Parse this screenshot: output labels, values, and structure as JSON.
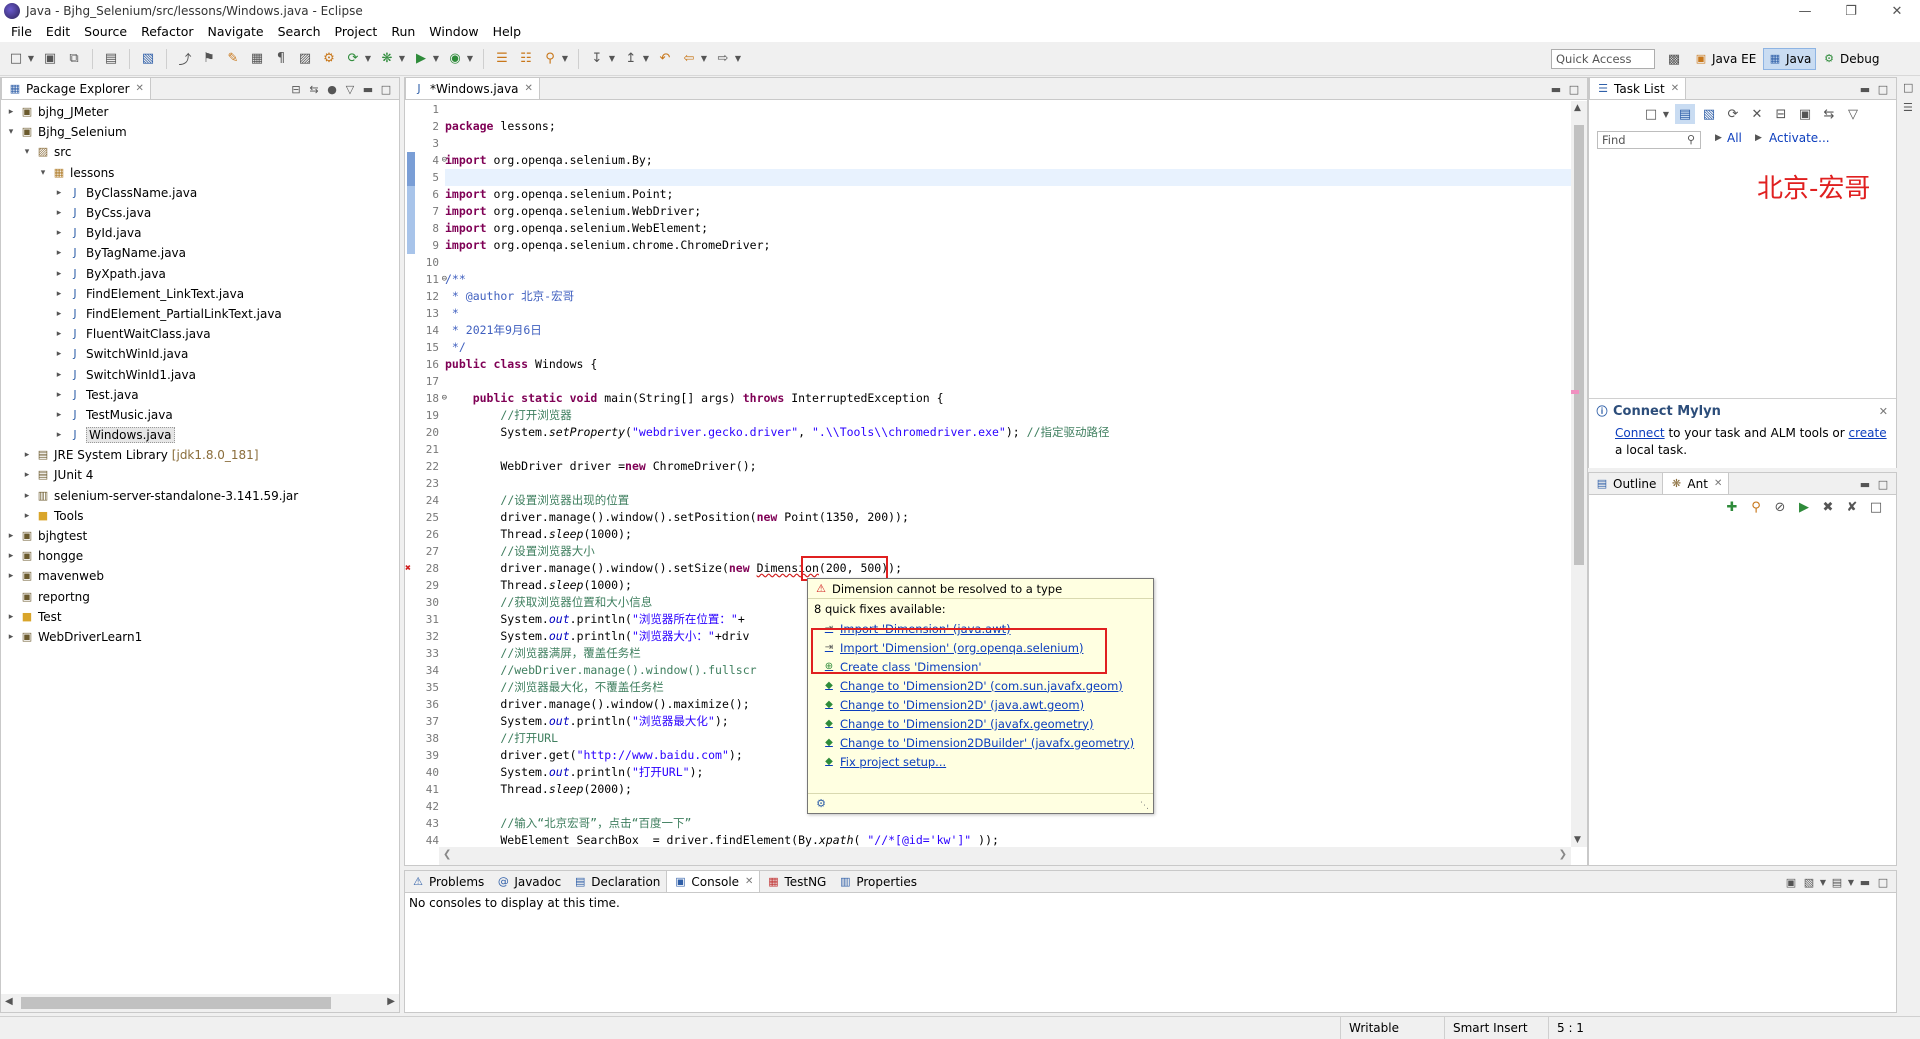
{
  "window": {
    "title": "Java - Bjhg_Selenium/src/lessons/Windows.java - Eclipse"
  },
  "menu": [
    "File",
    "Edit",
    "Source",
    "Refactor",
    "Navigate",
    "Search",
    "Project",
    "Run",
    "Window",
    "Help"
  ],
  "toolbar": {
    "quick_access_placeholder": "Quick Access",
    "perspectives": [
      {
        "label": "Java EE",
        "active": false
      },
      {
        "label": "Java",
        "active": true
      },
      {
        "label": "Debug",
        "active": false
      }
    ]
  },
  "package_explorer": {
    "tab": "Package Explorer",
    "items": [
      {
        "label": "bjhg_JMeter",
        "depth": 0,
        "toggle": "▸",
        "icon": "project-icon",
        "selected": false
      },
      {
        "label": "Bjhg_Selenium",
        "depth": 0,
        "toggle": "▾",
        "icon": "project-icon",
        "selected": false
      },
      {
        "label": "src",
        "depth": 1,
        "toggle": "▾",
        "icon": "source-folder-icon",
        "selected": false
      },
      {
        "label": "lessons",
        "depth": 2,
        "toggle": "▾",
        "icon": "package-icon",
        "selected": false
      },
      {
        "label": "ByClassName.java",
        "depth": 3,
        "toggle": "▸",
        "icon": "java-file-icon",
        "selected": false
      },
      {
        "label": "ByCss.java",
        "depth": 3,
        "toggle": "▸",
        "icon": "java-file-icon",
        "selected": false
      },
      {
        "label": "ById.java",
        "depth": 3,
        "toggle": "▸",
        "icon": "java-file-icon",
        "selected": false
      },
      {
        "label": "ByTagName.java",
        "depth": 3,
        "toggle": "▸",
        "icon": "java-file-icon",
        "selected": false
      },
      {
        "label": "ByXpath.java",
        "depth": 3,
        "toggle": "▸",
        "icon": "java-file-icon",
        "selected": false
      },
      {
        "label": "FindElement_LinkText.java",
        "depth": 3,
        "toggle": "▸",
        "icon": "java-file-icon",
        "selected": false
      },
      {
        "label": "FindElement_PartialLinkText.java",
        "depth": 3,
        "toggle": "▸",
        "icon": "java-file-icon",
        "selected": false
      },
      {
        "label": "FluentWaitClass.java",
        "depth": 3,
        "toggle": "▸",
        "icon": "java-file-icon",
        "selected": false
      },
      {
        "label": "SwitchWinId.java",
        "depth": 3,
        "toggle": "▸",
        "icon": "java-file-icon",
        "selected": false
      },
      {
        "label": "SwitchWinId1.java",
        "depth": 3,
        "toggle": "▸",
        "icon": "java-file-icon",
        "selected": false
      },
      {
        "label": "Test.java",
        "depth": 3,
        "toggle": "▸",
        "icon": "java-file-icon",
        "selected": false
      },
      {
        "label": "TestMusic.java",
        "depth": 3,
        "toggle": "▸",
        "icon": "java-file-icon",
        "selected": false
      },
      {
        "label": "Windows.java",
        "depth": 3,
        "toggle": "▸",
        "icon": "java-file-icon",
        "selected": true
      },
      {
        "label": "JRE System Library",
        "suffix": "[jdk1.8.0_181]",
        "depth": 1,
        "toggle": "▸",
        "icon": "library-icon",
        "selected": false
      },
      {
        "label": "JUnit 4",
        "depth": 1,
        "toggle": "▸",
        "icon": "library-icon",
        "selected": false
      },
      {
        "label": "selenium-server-standalone-3.141.59.jar",
        "depth": 1,
        "toggle": "▸",
        "icon": "jar-icon",
        "selected": false
      },
      {
        "label": "Tools",
        "depth": 1,
        "toggle": "▸",
        "icon": "folder-icon",
        "selected": false
      },
      {
        "label": "bjhgtest",
        "depth": 0,
        "toggle": "▸",
        "icon": "project-icon",
        "selected": false
      },
      {
        "label": "hongge",
        "depth": 0,
        "toggle": "▸",
        "icon": "project-icon",
        "selected": false
      },
      {
        "label": "mavenweb",
        "depth": 0,
        "toggle": "▸",
        "icon": "project-icon",
        "selected": false
      },
      {
        "label": "reportng",
        "depth": 0,
        "toggle": "",
        "icon": "project-icon",
        "selected": false
      },
      {
        "label": "Test",
        "depth": 0,
        "toggle": "▸",
        "icon": "folder-icon",
        "selected": false
      },
      {
        "label": "WebDriverLearn1",
        "depth": 0,
        "toggle": "▸",
        "icon": "project-icon",
        "selected": false
      }
    ]
  },
  "editor": {
    "tab": "*Windows.java",
    "current_line": 5,
    "lines": [
      {
        "n": "1",
        "marker": "",
        "html": ""
      },
      {
        "n": "2",
        "marker": "",
        "html": "<span class=\"kw\">package</span> lessons;"
      },
      {
        "n": "3",
        "marker": "",
        "html": ""
      },
      {
        "n": "4",
        "marker": "⊖",
        "html": "<span class=\"kw\">import</span> org.openqa.selenium.By;"
      },
      {
        "n": "5",
        "marker": "",
        "html": ""
      },
      {
        "n": "6",
        "marker": "",
        "html": "<span class=\"kw\">import</span> org.openqa.selenium.Point;"
      },
      {
        "n": "7",
        "marker": "",
        "html": "<span class=\"kw\">import</span> org.openqa.selenium.WebDriver;"
      },
      {
        "n": "8",
        "marker": "",
        "html": "<span class=\"kw\">import</span> org.openqa.selenium.WebElement;"
      },
      {
        "n": "9",
        "marker": "",
        "html": "<span class=\"kw\">import</span> org.openqa.selenium.chrome.ChromeDriver;"
      },
      {
        "n": "10",
        "marker": "",
        "html": ""
      },
      {
        "n": "11",
        "marker": "⊖",
        "html": "<span class=\"jd\">/**</span>"
      },
      {
        "n": "12",
        "marker": "",
        "html": "<span class=\"jd\"> * @author 北京-宏哥</span>"
      },
      {
        "n": "13",
        "marker": "",
        "html": "<span class=\"jd\"> *</span>"
      },
      {
        "n": "14",
        "marker": "",
        "html": "<span class=\"jd\"> * 2021年9月6日</span>"
      },
      {
        "n": "15",
        "marker": "",
        "html": "<span class=\"jd\"> */</span>"
      },
      {
        "n": "16",
        "marker": "",
        "html": "<span class=\"kw\">public class</span> Windows {"
      },
      {
        "n": "17",
        "marker": "",
        "html": ""
      },
      {
        "n": "18",
        "marker": "⊖",
        "html": "    <span class=\"kw\">public static void</span> main(String[] args) <span class=\"kw\">throws</span> InterruptedException {"
      },
      {
        "n": "19",
        "marker": "",
        "html": "        <span class=\"cm\">//打开浏览器</span>"
      },
      {
        "n": "20",
        "marker": "",
        "html": "        System.<i>setProperty</i>(<span class=\"st\">\"webdriver.gecko.driver\"</span>, <span class=\"st\">\".\\\\Tools\\\\chromedriver.exe\"</span>); <span class=\"cm\">//指定驱动路径</span>"
      },
      {
        "n": "21",
        "marker": "",
        "html": ""
      },
      {
        "n": "22",
        "marker": "",
        "html": "        WebDriver driver =<span class=\"kw\">new</span> ChromeDriver();"
      },
      {
        "n": "23",
        "marker": "",
        "html": ""
      },
      {
        "n": "24",
        "marker": "",
        "html": "        <span class=\"cm\">//设置浏览器出现的位置</span>"
      },
      {
        "n": "25",
        "marker": "",
        "html": "        driver.manage().window().setPosition(<span class=\"kw\">new</span> Point(1350, 200));"
      },
      {
        "n": "26",
        "marker": "",
        "html": "        Thread.<i>sleep</i>(1000);"
      },
      {
        "n": "27",
        "marker": "",
        "html": "        <span class=\"cm\">//设置浏览器大小</span>"
      },
      {
        "n": "28",
        "marker": "err",
        "html": "        driver.manage().window().setSize(<span class=\"kw\">new</span> Dimension(200, 500));"
      },
      {
        "n": "29",
        "marker": "",
        "html": "        Thread.<i>sleep</i>(1000);"
      },
      {
        "n": "30",
        "marker": "",
        "html": "        <span class=\"cm\">//获取浏览器位置和大小信息</span>"
      },
      {
        "n": "31",
        "marker": "",
        "html": "        System.<span class=\"fld it\">out</span>.println(<span class=\"st\">\"浏览器所在位置：\"</span>+"
      },
      {
        "n": "32",
        "marker": "",
        "html": "        System.<span class=\"fld it\">out</span>.println(<span class=\"st\">\"浏览器大小：\"</span>+driv"
      },
      {
        "n": "33",
        "marker": "",
        "html": "        <span class=\"cm\">//浏览器满屏，覆盖任务栏</span>"
      },
      {
        "n": "34",
        "marker": "",
        "html": "        <span class=\"cm\">//webDriver.manage().window().fullscr</span>"
      },
      {
        "n": "35",
        "marker": "",
        "html": "        <span class=\"cm\">//浏览器最大化，不覆盖任务栏</span>"
      },
      {
        "n": "36",
        "marker": "",
        "html": "        driver.manage().window().maximize();"
      },
      {
        "n": "37",
        "marker": "",
        "html": "        System.<span class=\"fld it\">out</span>.println(<span class=\"st\">\"浏览器最大化\"</span>);"
      },
      {
        "n": "38",
        "marker": "",
        "html": "        <span class=\"cm\">//打开URL</span>"
      },
      {
        "n": "39",
        "marker": "",
        "html": "        driver.get(<span class=\"st\">\"http://www.baidu.com\"</span>);"
      },
      {
        "n": "40",
        "marker": "",
        "html": "        System.<span class=\"fld it\">out</span>.println(<span class=\"st\">\"打开URL\"</span>);"
      },
      {
        "n": "41",
        "marker": "",
        "html": "        Thread.<i>sleep</i>(2000);"
      },
      {
        "n": "42",
        "marker": "",
        "html": ""
      },
      {
        "n": "43",
        "marker": "",
        "html": "        <span class=\"cm\">//输入“北京宏哥”，点击“百度一下”</span>"
      },
      {
        "n": "44",
        "marker": "",
        "html": "        WebElement SearchBox  = driver.findElement(By.<i>xpath</i>( <span class=\"st\">\"//*[@id='kw']\"</span> ));"
      }
    ]
  },
  "quickfix": {
    "error": "Dimension cannot be resolved to a type",
    "count_label": "8 quick fixes available:",
    "fixes": [
      {
        "label": "Import 'Dimension' (java.awt)",
        "icon": "import-icon"
      },
      {
        "label": "Import 'Dimension' (org.openqa.selenium)",
        "icon": "import-icon"
      },
      {
        "label": "Create class 'Dimension'",
        "icon": "create-class-icon"
      },
      {
        "label": "Change to 'Dimension2D' (com.sun.javafx.geom)",
        "icon": "change-icon"
      },
      {
        "label": "Change to 'Dimension2D' (java.awt.geom)",
        "icon": "change-icon"
      },
      {
        "label": "Change to 'Dimension2D' (javafx.geometry)",
        "icon": "change-icon"
      },
      {
        "label": "Change to 'Dimension2DBuilder' (javafx.geometry)",
        "icon": "change-icon"
      },
      {
        "label": "Fix project setup...",
        "icon": "setup-icon"
      }
    ]
  },
  "tasklist": {
    "tab": "Task List",
    "find_placeholder": "Find",
    "all_label": "All",
    "activate_label": "Activate...",
    "overlay_text": "北京-宏哥"
  },
  "mylyn": {
    "title": "Connect Mylyn",
    "link1": "Connect",
    "text1": " to your task and ALM tools or ",
    "link2": "create",
    "text2": "a local task."
  },
  "outline": {
    "tabs": [
      "Outline",
      "Ant"
    ]
  },
  "bottom": {
    "tabs": [
      "Problems",
      "Javadoc",
      "Declaration",
      "Console",
      "TestNG",
      "Properties"
    ],
    "active_tab": "Console",
    "message": "No consoles to display at this time."
  },
  "status": {
    "writable": "Writable",
    "insert_mode": "Smart Insert",
    "position": "5 : 1"
  },
  "colors": {
    "error_box": "#e02020",
    "accent": "#c9dcf2",
    "keyword": "#7f0055",
    "string": "#2a00ff",
    "comment": "#3f7f5f"
  }
}
